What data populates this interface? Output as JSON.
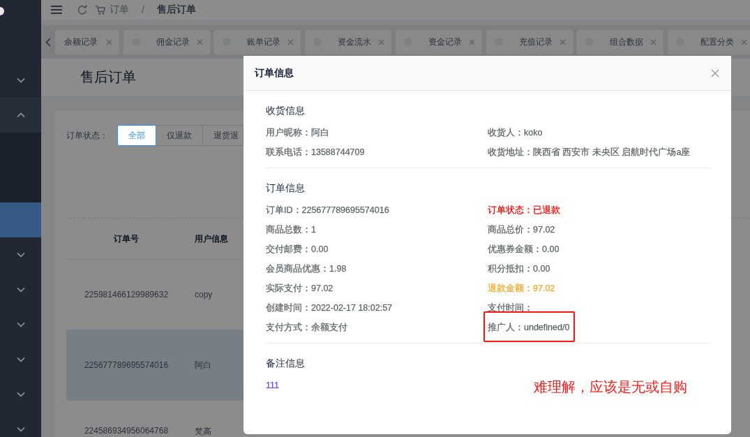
{
  "sidebar": {
    "groups": [
      {
        "expanded": false
      },
      {
        "expanded": true,
        "children": [
          {
            "selected": false
          },
          {
            "selected": false
          },
          {
            "selected": true
          }
        ]
      },
      {
        "expanded": false
      },
      {
        "expanded": false
      },
      {
        "expanded": false
      },
      {
        "expanded": false
      },
      {
        "expanded": false
      },
      {
        "expanded": false
      }
    ]
  },
  "breadcrumb": {
    "items": [
      "订单",
      "售后订单"
    ],
    "separator": "/"
  },
  "tabs": [
    {
      "label": "余额记录",
      "selected": false
    },
    {
      "label": "佣金记录",
      "selected": false
    },
    {
      "label": "账单记录",
      "selected": false
    },
    {
      "label": "资金流水",
      "selected": false
    },
    {
      "label": "资金记录",
      "selected": false
    },
    {
      "label": "充值记录",
      "selected": false
    },
    {
      "label": "组合数据",
      "selected": false
    },
    {
      "label": "配置分类",
      "selected": false
    }
  ],
  "page": {
    "title": "售后订单",
    "filter": {
      "label": "订单状态：",
      "options": [
        {
          "label": "全部",
          "selected": true
        },
        {
          "label": "仅退款",
          "selected": false
        },
        {
          "label": "退货退",
          "selected": false
        }
      ]
    },
    "table": {
      "columns": [
        "订单号",
        "用户信息"
      ],
      "rows": [
        {
          "cells": [
            "225981466129989632",
            "copy"
          ],
          "highlighted": false
        },
        {
          "cells": [
            "225677789695574016",
            "阿白"
          ],
          "highlighted": true
        },
        {
          "cells": [
            "224586934956064768",
            "梵高"
          ],
          "highlighted": false
        }
      ]
    }
  },
  "modal": {
    "title": "订单信息",
    "sections": [
      {
        "title": "收货信息",
        "fields": [
          {
            "text": "用户昵称：阿白",
            "color": "#606266",
            "boxed": false
          },
          {
            "text": "收货人：koko",
            "color": "#606266",
            "boxed": false
          },
          {
            "text": "联系电话：13588744709",
            "color": "#606266",
            "boxed": false
          },
          {
            "text": "收货地址：陕西省 西安市 未央区 启航时代广场a座",
            "color": "#606266",
            "boxed": false
          }
        ]
      },
      {
        "title": "订单信息",
        "fields": [
          {
            "text": "订单ID：225677789695574016",
            "color": "#606266",
            "boxed": false
          },
          {
            "text": "订单状态：已退款",
            "color": "#ff0000",
            "boxed": false
          },
          {
            "text": "商品总数：1",
            "color": "#606266",
            "boxed": false
          },
          {
            "text": "商品总价：97.02",
            "color": "#606266",
            "boxed": false
          },
          {
            "text": "交付邮费：0.00",
            "color": "#606266",
            "boxed": false
          },
          {
            "text": "优惠券金额：0.00",
            "color": "#606266",
            "boxed": false
          },
          {
            "text": "会员商品优惠：1.98",
            "color": "#606266",
            "boxed": false
          },
          {
            "text": "积分抵扣：0.00",
            "color": "#606266",
            "boxed": false
          },
          {
            "text": "实际支付：97.02",
            "color": "#606266",
            "boxed": false
          },
          {
            "text": "退款金额：97.02",
            "color": "#f5a623",
            "boxed": false
          },
          {
            "text": "创建时间：2022-02-17 18:02:57",
            "color": "#606266",
            "boxed": false
          },
          {
            "text": "支付时间：",
            "color": "#606266",
            "boxed": false
          },
          {
            "text": "支付方式：余额支付",
            "color": "#606266",
            "boxed": false
          },
          {
            "text": "推广人：undefined/0",
            "color": "#606266",
            "boxed": true
          }
        ]
      },
      {
        "title": "备注信息",
        "fields": [
          {
            "text": "111",
            "color": "#7546e8",
            "boxed": false
          }
        ]
      }
    ],
    "annotation": "难理解，应该是无或自购"
  }
}
